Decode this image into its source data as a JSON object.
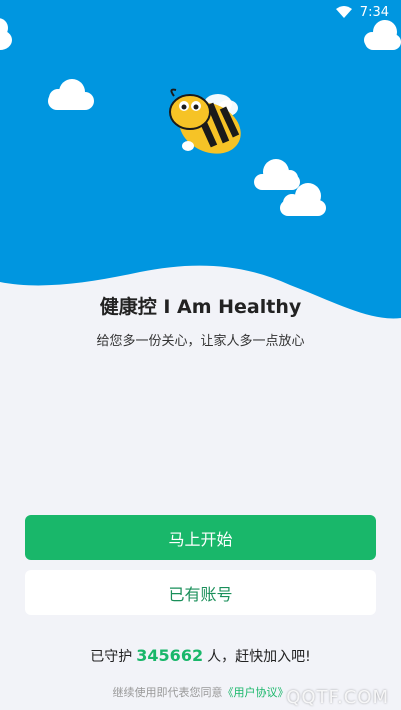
{
  "status_bar": {
    "time": "7:34",
    "wifi_icon": "wifi-icon"
  },
  "hero": {
    "sky_color": "#0096e0",
    "mascot_icon": "bee-icon"
  },
  "title": "健康控 I Am Healthy",
  "subtitle": "给您多一份关心，让家人多一点放心",
  "buttons": {
    "start_label": "马上开始",
    "login_label": "已有账号"
  },
  "protect": {
    "prefix": "已守护",
    "count": "345662",
    "suffix": "人，赶快加入吧!"
  },
  "agreement": {
    "text": "继续使用即代表您同意",
    "link": "《用户协议》"
  },
  "watermark": "QQTF.COM",
  "colors": {
    "primary": "#19b76a",
    "background": "#f2f3f8"
  }
}
